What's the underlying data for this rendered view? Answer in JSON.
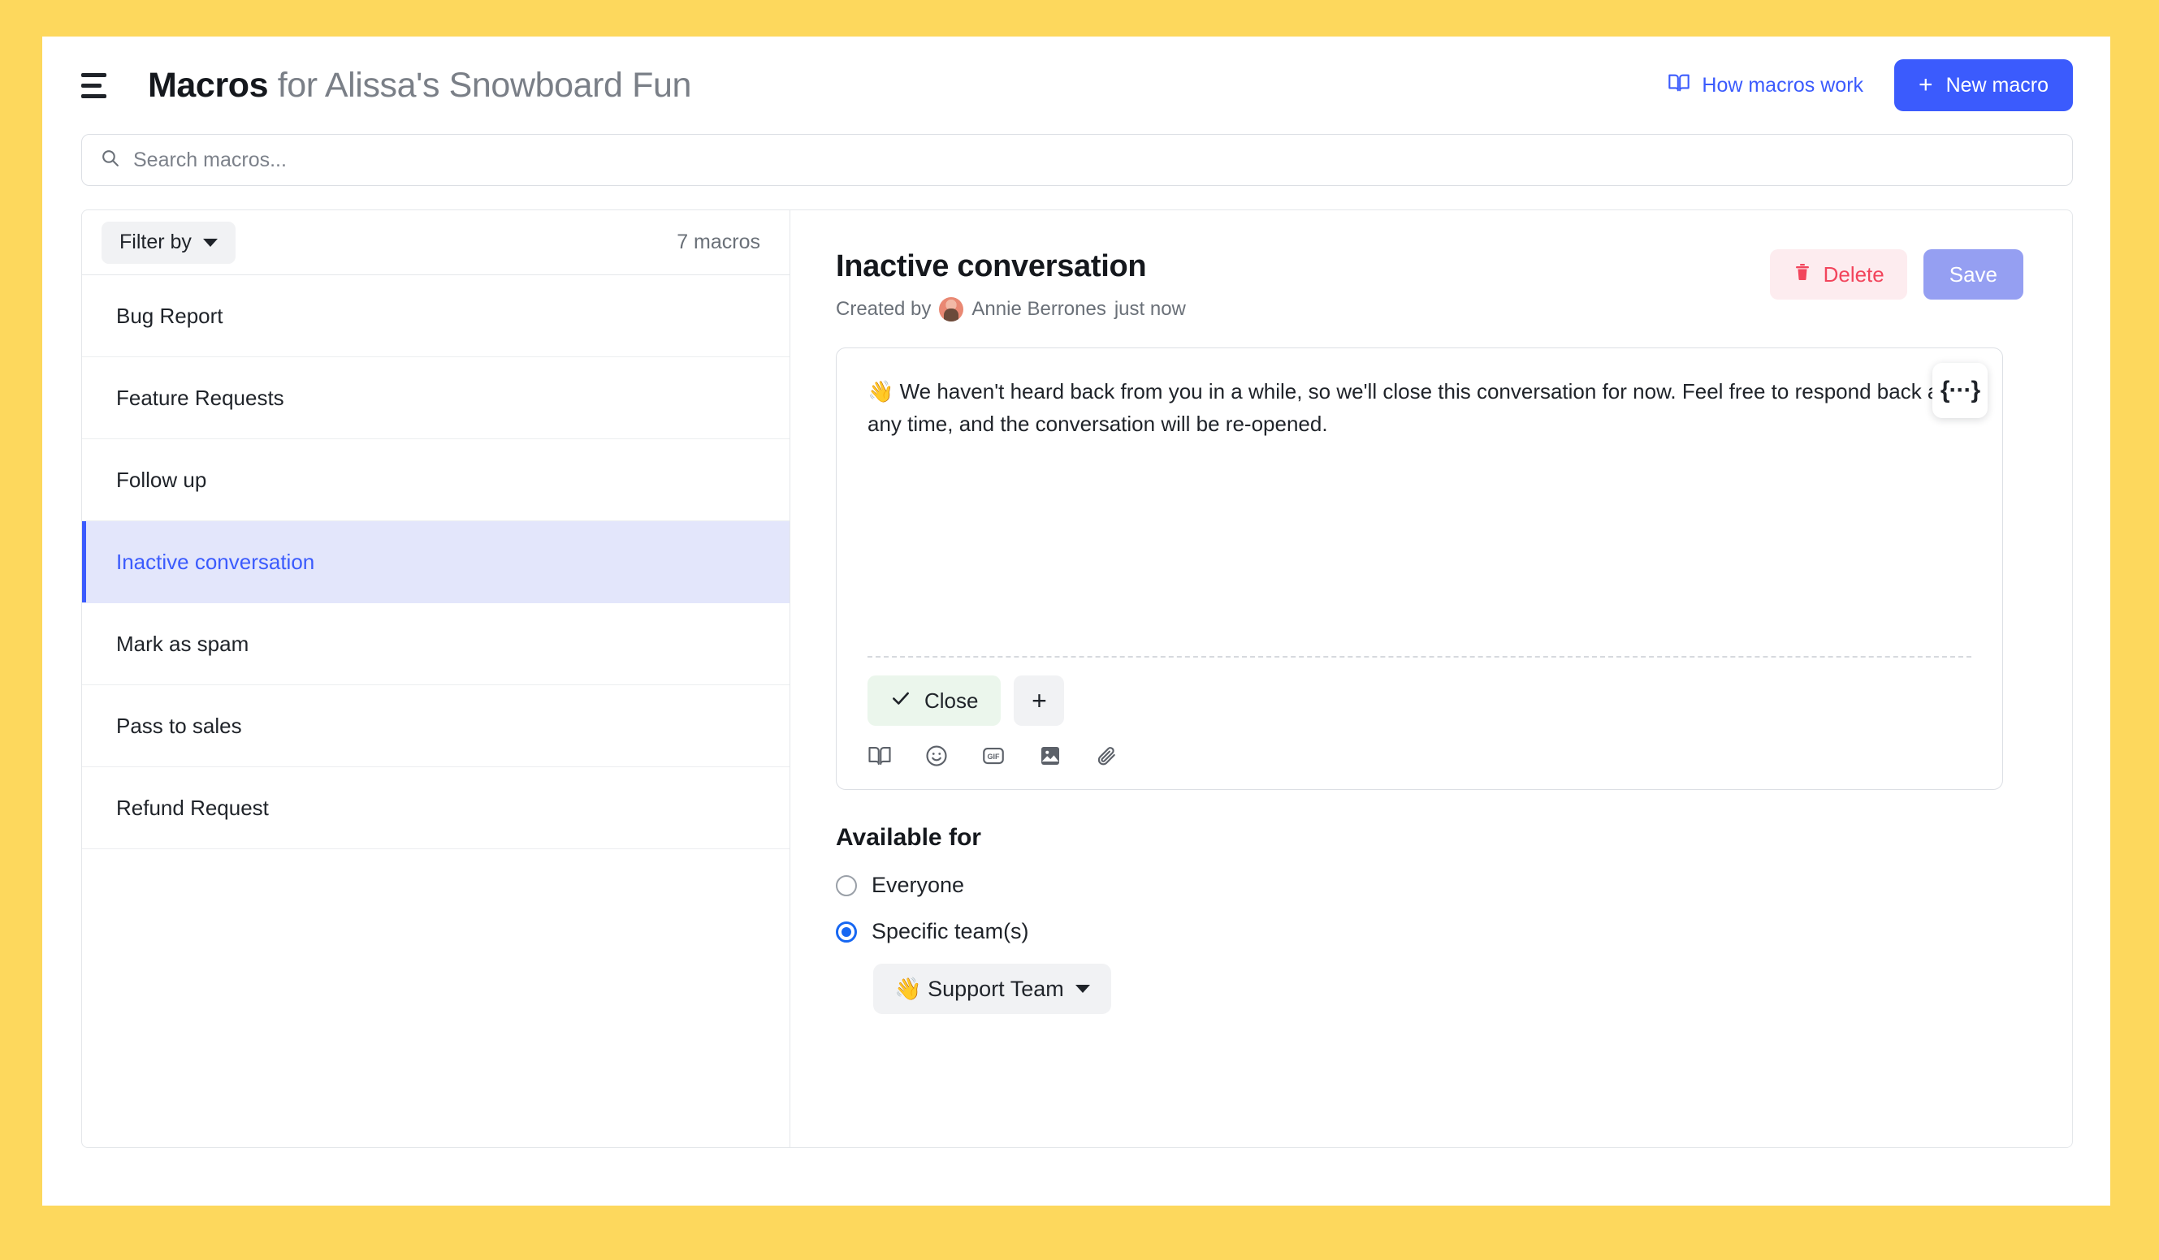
{
  "header": {
    "menu_icon": "hamburger-icon",
    "title_bold": "Macros",
    "title_rest": " for Alissa's Snowboard Fun",
    "how_macros_link": "How macros work",
    "how_macros_icon": "book-icon",
    "new_macro_button": "New macro",
    "new_macro_plus": "+"
  },
  "search": {
    "placeholder": "Search macros...",
    "value": "",
    "icon": "search-icon"
  },
  "list": {
    "filter_label": "Filter by",
    "count_label": "7 macros",
    "items": [
      {
        "label": "Bug Report",
        "active": false
      },
      {
        "label": "Feature Requests",
        "active": false
      },
      {
        "label": "Follow up",
        "active": false
      },
      {
        "label": "Inactive conversation",
        "active": true
      },
      {
        "label": "Mark as spam",
        "active": false
      },
      {
        "label": "Pass to sales",
        "active": false
      },
      {
        "label": "Refund Request",
        "active": false
      }
    ]
  },
  "detail": {
    "title": "Inactive conversation",
    "created_prefix": "Created by",
    "author": "Annie Berrones",
    "created_suffix": "just now",
    "delete_button": "Delete",
    "delete_icon": "trash-icon",
    "save_button": "Save",
    "editor": {
      "message": "👋 We haven't heard back from you in a while, so we'll close this conversation for now. Feel free to respond back at any time, and the conversation will be re-opened.",
      "close_action": "Close",
      "close_icon": "check-icon",
      "add_action": "+",
      "toolbar_icons": [
        "book-icon",
        "emoji-icon",
        "gif-icon",
        "image-icon",
        "attachment-icon"
      ],
      "variable_button": "{···}"
    },
    "available": {
      "heading": "Available for",
      "options": [
        {
          "label": "Everyone",
          "selected": false
        },
        {
          "label": "Specific team(s)",
          "selected": true
        }
      ],
      "team_chip": "👋 Support Team"
    }
  },
  "colors": {
    "page_border": "#fdd85d",
    "accent": "#3b5bfd",
    "danger": "#f2455c",
    "save_disabled": "#959ff2",
    "active_row_bg": "#e3e6fb"
  }
}
